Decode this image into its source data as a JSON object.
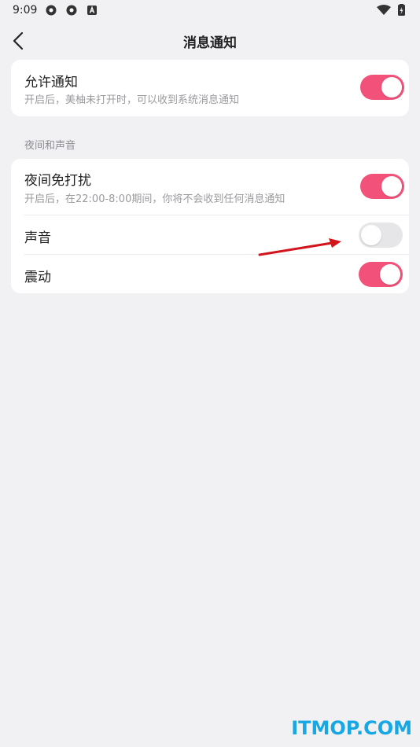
{
  "status_bar": {
    "time": "9:09",
    "left_icons": [
      "aperture-icon",
      "aperture-icon",
      "app-a-icon"
    ],
    "right_icons": [
      "wifi-icon",
      "battery-charging-icon"
    ]
  },
  "nav": {
    "back_icon": "chevron-left-icon",
    "title": "消息通知"
  },
  "allow_section": {
    "title": "允许通知",
    "subtitle": "开启后，美柚未打开时，可以收到系统消息通知",
    "enabled": true
  },
  "night_section": {
    "label": "夜间和声音",
    "rows": [
      {
        "title": "夜间免打扰",
        "subtitle": "开启后，在22:00-8:00期间，你将不会收到任何消息通知",
        "enabled": true
      },
      {
        "title": "声音",
        "enabled": false
      },
      {
        "title": "震动",
        "enabled": true
      }
    ]
  },
  "colors": {
    "accent": "#f2527a",
    "toggle_off": "#e6e6e9",
    "background": "#f1f1f4",
    "arrow": "#d4141c"
  },
  "watermark": "ITMOP.COM"
}
